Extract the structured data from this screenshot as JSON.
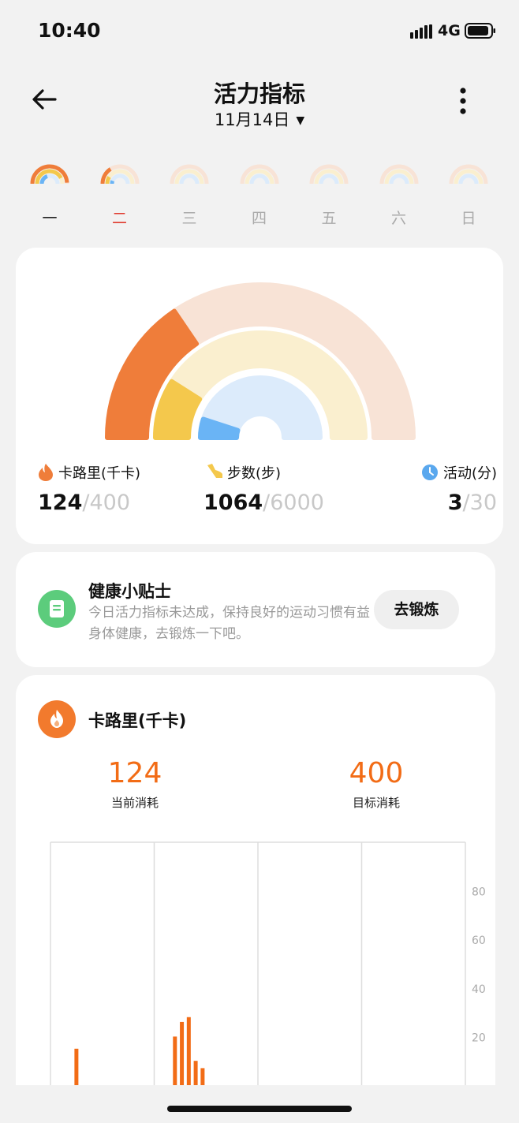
{
  "status_bar": {
    "time": "10:40",
    "network": "4G"
  },
  "header": {
    "title": "活力指标",
    "date": "11月14日"
  },
  "week": {
    "days": [
      {
        "label": "一",
        "state": "done"
      },
      {
        "label": "二",
        "state": "selected"
      },
      {
        "label": "三",
        "state": "future"
      },
      {
        "label": "四",
        "state": "future"
      },
      {
        "label": "五",
        "state": "future"
      },
      {
        "label": "六",
        "state": "future"
      },
      {
        "label": "日",
        "state": "future"
      }
    ]
  },
  "summary": {
    "calories": {
      "label": "卡路里(千卡)",
      "current": "124",
      "goal": "/400",
      "progress": 0.31
    },
    "steps": {
      "label": "步数(步)",
      "current": "1064",
      "goal": "/6000",
      "progress": 0.18
    },
    "activity": {
      "label": "活动(分)",
      "current": "3",
      "goal": "/30",
      "progress": 0.1
    }
  },
  "colors": {
    "calories": "#ef7d3a",
    "calories_track": "#f8e3d6",
    "steps": "#f4c84c",
    "steps_track": "#faefcf",
    "activity": "#6ab4f5",
    "activity_track": "#dcebfb",
    "accent": "#f26c16"
  },
  "tip": {
    "title": "健康小贴士",
    "text": "今日活力指标未达成，保持良好的运动习惯有益身体健康，去锻炼一下吧。",
    "button": "去锻炼"
  },
  "calorie_section": {
    "title": "卡路里(千卡)",
    "current_value": "124",
    "current_label": "当前消耗",
    "goal_value": "400",
    "goal_label": "目标消耗"
  },
  "chart_data": {
    "type": "bar",
    "y_ticks": [
      "80",
      "60",
      "40",
      "20"
    ],
    "ylim": [
      0,
      100
    ],
    "x": [
      1.5,
      7.2,
      7.6,
      8.0,
      8.4,
      8.8
    ],
    "values": [
      15,
      20,
      26,
      28,
      10,
      7
    ],
    "xlim": [
      0,
      24
    ],
    "grid": true
  }
}
